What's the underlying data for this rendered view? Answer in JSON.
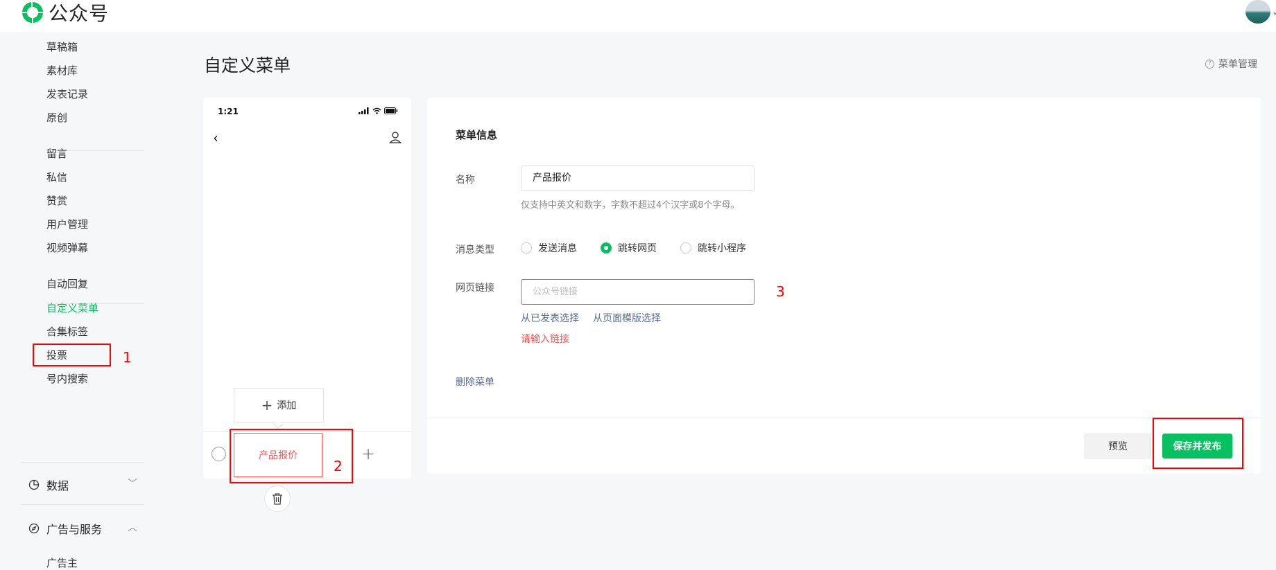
{
  "header": {
    "brand": "公众号"
  },
  "sidebar": {
    "items": [
      "草稿箱",
      "素材库",
      "发表记录",
      "原创",
      "留言",
      "私信",
      "赞赏",
      "用户管理",
      "视频弹幕",
      "自动回复",
      "自定义菜单",
      "合集标签",
      "投票",
      "号内搜索"
    ],
    "active": "自定义菜单",
    "groups": [
      {
        "label": "数据",
        "chevron": "﹀"
      },
      {
        "label": "广告与服务",
        "chevron": "︿"
      }
    ],
    "trailing_item": "广告主"
  },
  "page": {
    "title": "自定义菜单",
    "menu_manage": "菜单管理",
    "help_glyph": "?"
  },
  "phone": {
    "time": "1:21",
    "add_label": "添加",
    "menu_tab": "产品报价"
  },
  "form": {
    "section_title": "菜单信息",
    "name_label": "名称",
    "name_value": "产品报价",
    "name_hint": "仅支持中英文和数字，字数不超过4个汉字或8个字母。",
    "type_label": "消息类型",
    "type_options": [
      "发送消息",
      "跳转网页",
      "跳转小程序"
    ],
    "type_selected": "跳转网页",
    "url_label": "网页链接",
    "url_placeholder": "公众号链接",
    "url_value": "",
    "select_published": "从已发表选择",
    "select_template": "从页面模版选择",
    "url_error": "请输入链接",
    "delete_menu": "删除菜单",
    "preview_button": "预览",
    "publish_button": "保存并发布"
  },
  "annotations": [
    "1",
    "2",
    "3"
  ],
  "colors": {
    "accent": "#07c160",
    "error": "#fa5151",
    "link": "#576b95",
    "annotation": "#ff0000"
  }
}
